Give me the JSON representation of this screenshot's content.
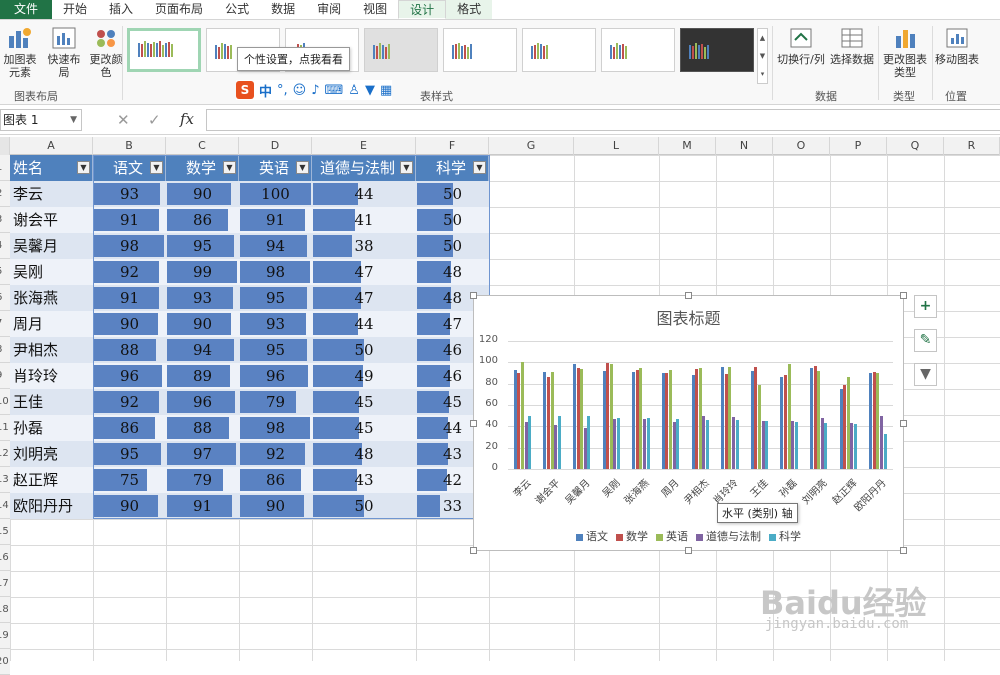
{
  "tabs": [
    "文件",
    "开始",
    "插入",
    "页面布局",
    "公式",
    "数据",
    "审阅",
    "视图",
    "设计",
    "格式"
  ],
  "ribbon": {
    "add_element": "加图表元素",
    "quick_layout": "快速布局",
    "change_color": "更改颜色",
    "group_layout": "图表布局",
    "group_styles": "表样式",
    "tooltip": "个性设置，点我看看",
    "switch_rowcol": "切换行/列",
    "select_data": "选择数据",
    "group_data": "数据",
    "change_type": "更改图表类型",
    "group_type": "类型",
    "move_chart": "移动图表",
    "group_location": "位置"
  },
  "ime": {
    "s": "S",
    "zh": "中"
  },
  "formula_bar": {
    "name_box": "图表 1",
    "fx": "fx",
    "cancel": "✕",
    "enter": "✓"
  },
  "columns": [
    "A",
    "B",
    "C",
    "D",
    "E",
    "F",
    "G",
    "L",
    "M",
    "N",
    "O",
    "P",
    "Q",
    "R"
  ],
  "rows": [
    "1",
    "2",
    "3",
    "4",
    "5",
    "6",
    "7",
    "8",
    "9",
    "10",
    "11",
    "12",
    "13",
    "14",
    "15",
    "16",
    "17",
    "18",
    "19",
    "20"
  ],
  "table": {
    "headers": [
      "姓名",
      "语文",
      "数学",
      "英语",
      "道德与法制",
      "科学"
    ],
    "records": [
      {
        "name": "李云",
        "v": [
          93,
          90,
          100,
          44,
          50
        ]
      },
      {
        "name": "谢会平",
        "v": [
          91,
          86,
          91,
          41,
          50
        ]
      },
      {
        "name": "吴馨月",
        "v": [
          98,
          95,
          94,
          38,
          50
        ]
      },
      {
        "name": "吴刚",
        "v": [
          92,
          99,
          98,
          47,
          48
        ]
      },
      {
        "name": "张海燕",
        "v": [
          91,
          93,
          95,
          47,
          48
        ]
      },
      {
        "name": "周月",
        "v": [
          90,
          90,
          93,
          44,
          47
        ]
      },
      {
        "name": "尹相杰",
        "v": [
          88,
          94,
          95,
          50,
          46
        ]
      },
      {
        "name": "肖玲玲",
        "v": [
          96,
          89,
          96,
          49,
          46
        ]
      },
      {
        "name": "王佳",
        "v": [
          92,
          96,
          79,
          45,
          45
        ]
      },
      {
        "name": "孙磊",
        "v": [
          86,
          88,
          98,
          45,
          44
        ]
      },
      {
        "name": "刘明亮",
        "v": [
          95,
          97,
          92,
          48,
          43
        ]
      },
      {
        "name": "赵正辉",
        "v": [
          75,
          79,
          86,
          43,
          42
        ]
      },
      {
        "name": "欧阳丹丹",
        "v": [
          90,
          91,
          90,
          50,
          33
        ]
      }
    ]
  },
  "chart_data": {
    "type": "bar",
    "title": "图表标题",
    "categories": [
      "李云",
      "谢会平",
      "吴馨月",
      "吴刚",
      "张海燕",
      "周月",
      "尹相杰",
      "肖玲玲",
      "王佳",
      "孙磊",
      "刘明亮",
      "赵正辉",
      "欧阳丹丹"
    ],
    "series": [
      {
        "name": "语文",
        "color": "#4f81bd",
        "values": [
          93,
          91,
          98,
          92,
          91,
          90,
          88,
          96,
          92,
          86,
          95,
          75,
          90
        ]
      },
      {
        "name": "数学",
        "color": "#c0504d",
        "values": [
          90,
          86,
          95,
          99,
          93,
          90,
          94,
          89,
          96,
          88,
          97,
          79,
          91
        ]
      },
      {
        "name": "英语",
        "color": "#9bbb59",
        "values": [
          100,
          91,
          94,
          98,
          95,
          93,
          95,
          96,
          79,
          98,
          92,
          86,
          90
        ]
      },
      {
        "name": "道德与法制",
        "color": "#8064a2",
        "values": [
          44,
          41,
          38,
          47,
          47,
          44,
          50,
          49,
          45,
          45,
          48,
          43,
          50
        ]
      },
      {
        "name": "科学",
        "color": "#4bacc6",
        "values": [
          50,
          50,
          50,
          48,
          48,
          47,
          46,
          46,
          45,
          44,
          43,
          42,
          33
        ]
      }
    ],
    "ylim": [
      0,
      120
    ],
    "yticks": [
      0,
      20,
      40,
      60,
      80,
      100,
      120
    ],
    "legend": "bottom",
    "grid": true
  },
  "axis_tooltip": "水平 (类别) 轴",
  "side_buttons": [
    "+",
    "✎",
    "▼"
  ],
  "watermark": {
    "logo": "Baidu经验",
    "url": "jingyan.baidu.com"
  }
}
